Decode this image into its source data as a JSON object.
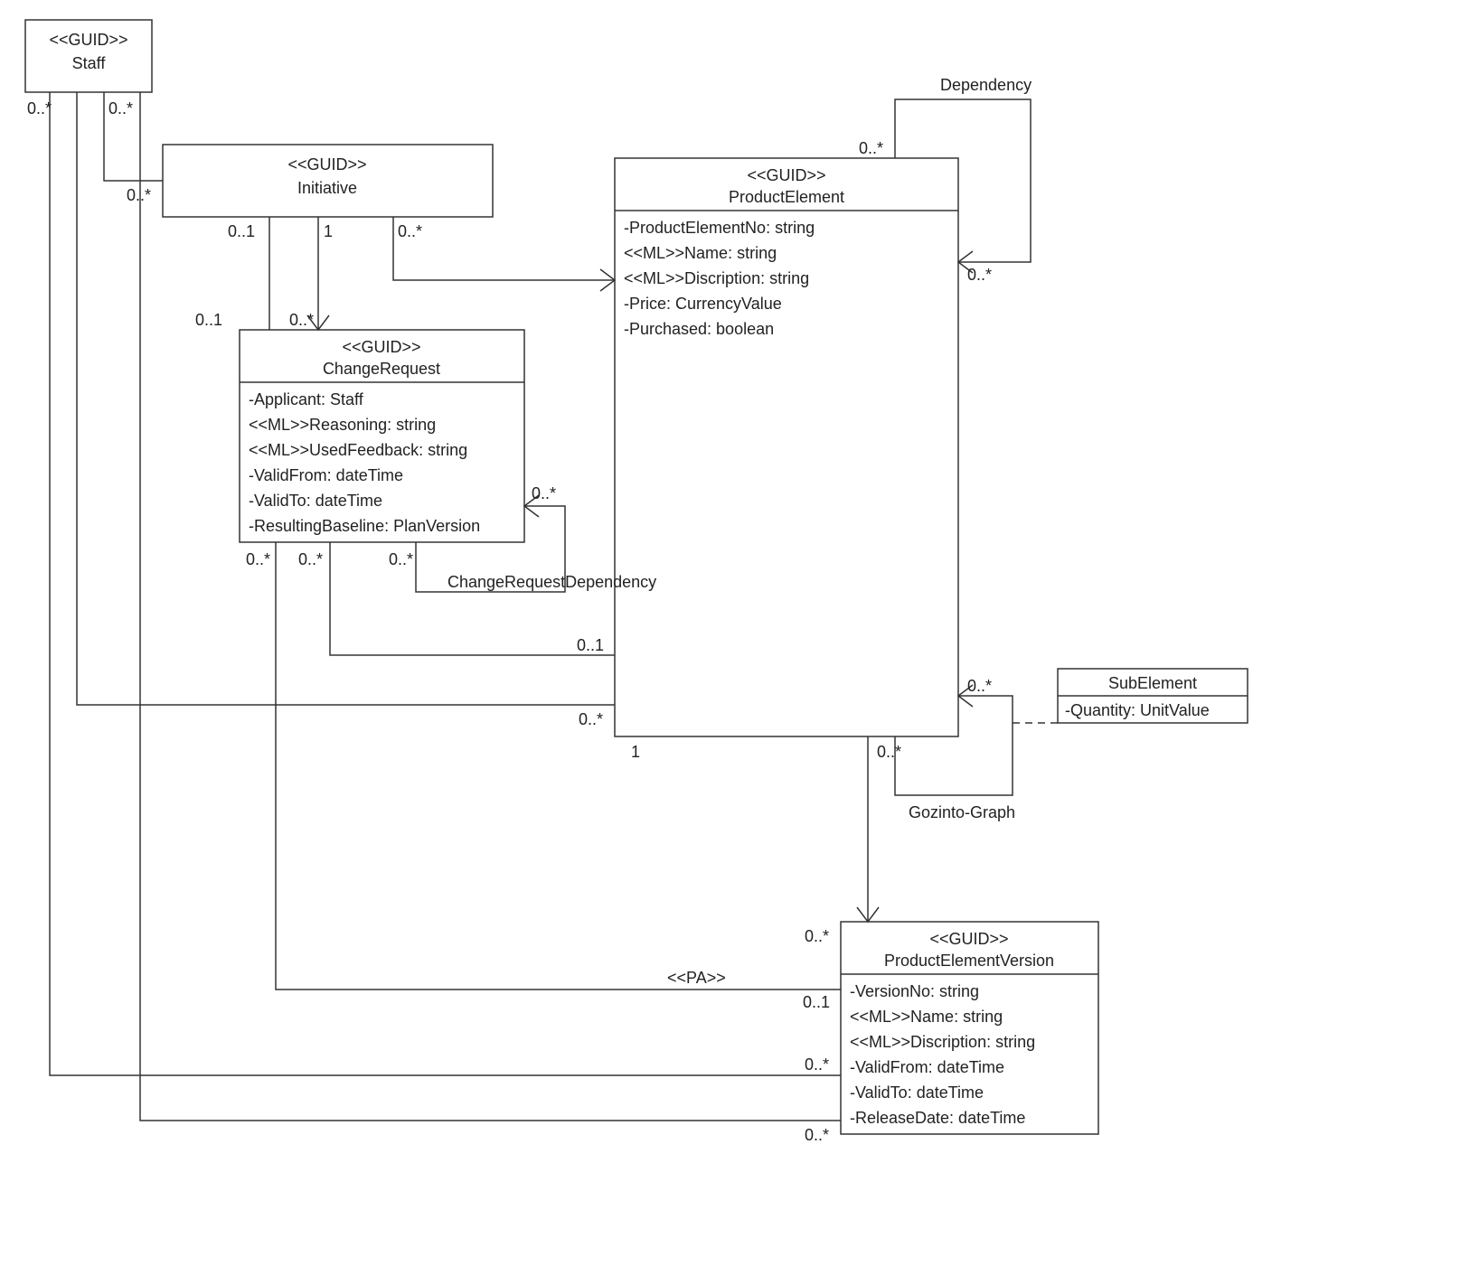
{
  "classes": {
    "staff": {
      "stereotype": "<<GUID>>",
      "name": "Staff"
    },
    "initiative": {
      "stereotype": "<<GUID>>",
      "name": "Initiative"
    },
    "changeRequest": {
      "stereotype": "<<GUID>>",
      "name": "ChangeRequest",
      "attrs": [
        "-Applicant: Staff",
        "<<ML>>Reasoning: string",
        "<<ML>>UsedFeedback: string",
        "-ValidFrom: dateTime",
        "-ValidTo: dateTime",
        "-ResultingBaseline: PlanVersion"
      ]
    },
    "productElement": {
      "stereotype": "<<GUID>>",
      "name": "ProductElement",
      "attrs": [
        "-ProductElementNo: string",
        "<<ML>>Name: string",
        "<<ML>>Discription: string",
        "-Price: CurrencyValue",
        "-Purchased: boolean"
      ]
    },
    "subElement": {
      "name": "SubElement",
      "attrs": [
        "-Quantity: UnitValue"
      ]
    },
    "productElementVersion": {
      "stereotype": "<<GUID>>",
      "name": "ProductElementVersion",
      "attrs": [
        "-VersionNo: string",
        "<<ML>>Name: string",
        "<<ML>>Discription: string",
        "-ValidFrom: dateTime",
        "-ValidTo: dateTime",
        "-ReleaseDate: dateTime"
      ]
    }
  },
  "labels": {
    "dependency": "Dependency",
    "gozinto": "Gozinto-Graph",
    "crDependency": "ChangeRequestDependency",
    "pa": "<<PA>>"
  },
  "mult": {
    "zeroStar": "0..*",
    "zeroOne": "0..1",
    "one": "1"
  }
}
